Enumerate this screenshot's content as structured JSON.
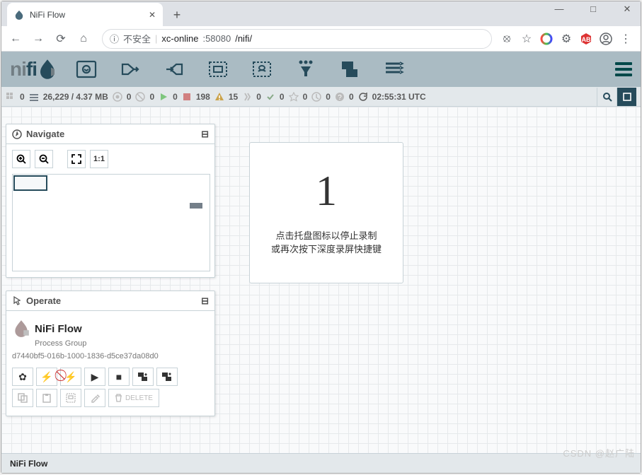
{
  "browser": {
    "tab_title": "NiFi Flow",
    "url_prefix_icon": "不安全",
    "url_host": "xc-online",
    "url_port": ":58080",
    "url_path": "/nifi/"
  },
  "status": {
    "threads": "0",
    "queue": "26,229 / 4.37 MB",
    "transmitting": "0",
    "not_transmitting": "0",
    "running": "0",
    "stopped": "198",
    "invalid": "15",
    "disabled": "0",
    "up_to_date": "0",
    "locally_modified": "0",
    "stale": "0",
    "sync_fail": "0",
    "last_refresh": "02:55:31 UTC"
  },
  "navigate": {
    "title": "Navigate"
  },
  "operate": {
    "title": "Operate",
    "flow_name": "NiFi Flow",
    "flow_type": "Process Group",
    "flow_id": "d7440bf5-016b-1000-1836-d5ce37da08d0",
    "delete_label": "DELETE"
  },
  "overlay": {
    "big": "1",
    "line1": "点击托盘图标以停止录制",
    "line2": "或再次按下深度录屏快捷键"
  },
  "breadcrumb": "NiFi Flow",
  "watermark": "CSDN @赵广陆"
}
